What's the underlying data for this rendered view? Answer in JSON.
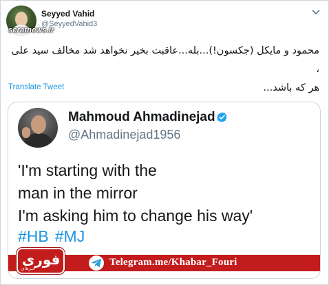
{
  "tweet": {
    "author_name": "Seyyed Vahid",
    "author_handle": "@SeyyedVahid3",
    "watermark": "seratnews.ir",
    "text_line1": "محمود و مایکل (جکسون!)...بله...عاقبت بخیر نخواهد شد مخالف سید علی ،",
    "text_line2": "هر که باشد...",
    "translate_label": "Translate Tweet"
  },
  "quoted": {
    "name": "Mahmoud Ahmadinejad",
    "handle": "@Ahmadinejad1956",
    "lines": [
      "'I'm starting with the",
      "man in the mirror",
      "I'm asking him to change his way'"
    ],
    "hashtags": [
      "#HB",
      "#MJ"
    ]
  },
  "footer": {
    "logo_text": "فوری",
    "logo_sub": "خبرهای",
    "telegram_link": "Telegram.me/Khabar_Fouri"
  },
  "colors": {
    "link_blue": "#1b95e0",
    "footer_red": "#c21c1c",
    "muted_gray": "#657786"
  },
  "icons": [
    "verified-icon",
    "telegram-icon",
    "chevron-down-icon"
  ]
}
